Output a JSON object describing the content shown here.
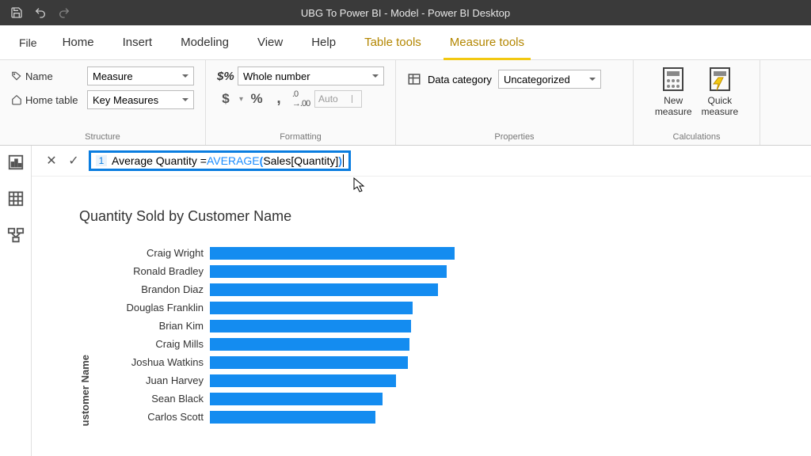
{
  "titlebar": {
    "title": "UBG To Power BI - Model - Power BI Desktop"
  },
  "menu": {
    "file": "File",
    "tabs": [
      "Home",
      "Insert",
      "Modeling",
      "View",
      "Help",
      "Table tools",
      "Measure tools"
    ],
    "active": "Measure tools"
  },
  "ribbon": {
    "structure": {
      "name_label": "Name",
      "name_value": "Measure",
      "home_table_label": "Home table",
      "home_table_value": "Key Measures",
      "group": "Structure"
    },
    "formatting": {
      "format_value": "Whole number",
      "currency": "$",
      "percent": "%",
      "comma": ",",
      "decimals_btn": ".00",
      "auto": "Auto",
      "group": "Formatting"
    },
    "properties": {
      "label": "Data category",
      "value": "Uncategorized",
      "group": "Properties"
    },
    "calculations": {
      "new": "New measure",
      "quick": "Quick measure",
      "group": "Calculations"
    }
  },
  "formula": {
    "line": "1",
    "prefix": "Average Quantity = ",
    "fn": "AVERAGE",
    "arg": " Sales[Quantity] "
  },
  "chart_data": {
    "type": "bar",
    "title": "Quantity Sold by Customer Name",
    "ylabel": "ustomer Name",
    "categories": [
      "Craig Wright",
      "Ronald Bradley",
      "Brandon Diaz",
      "Douglas Franklin",
      "Brian Kim",
      "Craig Mills",
      "Joshua Watkins",
      "Juan Harvey",
      "Sean Black",
      "Carlos Scott"
    ],
    "values": [
      290,
      280,
      270,
      240,
      238,
      236,
      234,
      220,
      204,
      196
    ],
    "xlim": [
      0,
      300
    ]
  }
}
